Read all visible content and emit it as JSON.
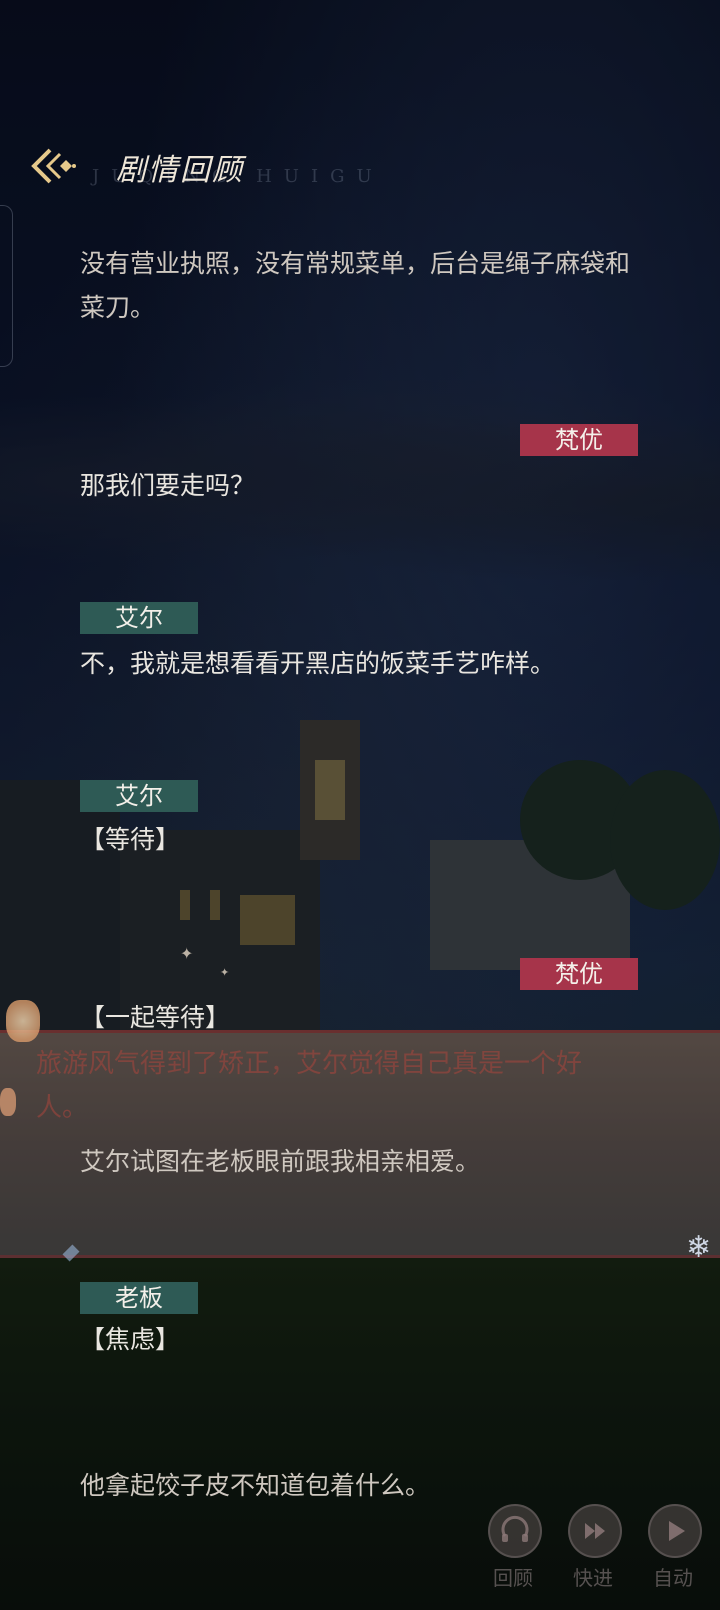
{
  "header": {
    "title": "剧情回顾",
    "subtitle": "JUQING HUIGU"
  },
  "entries": [
    {
      "text": "没有营业执照，没有常规菜单，后台是绳子麻袋和菜刀。"
    },
    {
      "speaker": "梵优",
      "text": "那我们要走吗？"
    },
    {
      "speaker": "艾尔",
      "text": "不，我就是想看看开黑店的饭菜手艺咋样。"
    },
    {
      "speaker": "艾尔",
      "text": "【等待】"
    },
    {
      "speaker": "梵优",
      "text": "【一起等待】"
    },
    {
      "text": "艾尔试图在老板眼前跟我相亲相爱。"
    },
    {
      "speaker": "老板",
      "text": "【焦虑】"
    },
    {
      "text": "他拿起饺子皮不知道包着什么。"
    }
  ],
  "background_text": {
    "line1": "旅游风气得到了矫正，艾尔觉得自己真是一个好",
    "line2": "人。"
  },
  "controls": {
    "review": "回顾",
    "fast_forward": "快进",
    "auto": "自动"
  },
  "colors": {
    "speaker_left_tag": "#2e5a55",
    "speaker_right_tag": "#a6344a"
  }
}
